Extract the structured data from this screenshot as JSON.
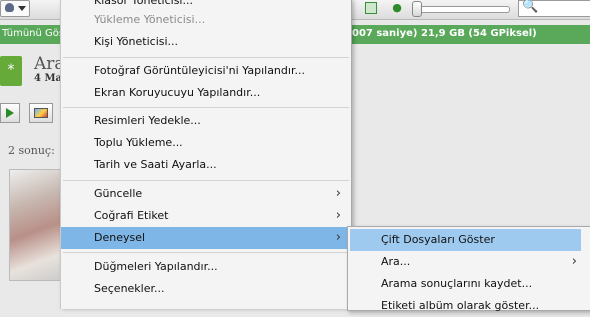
{
  "status_bar": {
    "show_all_label": "Tümünü Göst",
    "storage_info": "007 saniye) 21,9 GB (54 GPiksel)"
  },
  "toolbar": {
    "search_placeholder": ""
  },
  "album": {
    "title": "Ara",
    "date": "4 Ma"
  },
  "results": {
    "count_label": "2 sonuç:"
  },
  "menu": {
    "items": [
      {
        "label": "Klasör Yöneticisi..."
      },
      {
        "label": "Yükleme Yöneticisi..."
      },
      {
        "label": "Kişi Yöneticisi..."
      },
      {
        "label": "Fotoğraf Görüntüleyicisi'ni Yapılandır..."
      },
      {
        "label": "Ekran Koruyucuyu Yapılandır..."
      },
      {
        "label": "Resimleri Yedekle..."
      },
      {
        "label": "Toplu Yükleme..."
      },
      {
        "label": "Tarih ve Saati Ayarla..."
      },
      {
        "label": "Güncelle"
      },
      {
        "label": "Coğrafi Etiket"
      },
      {
        "label": "Deneysel"
      },
      {
        "label": "Düğmeleri Yapılandır..."
      },
      {
        "label": "Seçenekler..."
      }
    ]
  },
  "submenu": {
    "items": [
      {
        "label": "Çift Dosyaları Göster"
      },
      {
        "label": "Ara..."
      },
      {
        "label": "Arama sonuçlarını kaydet..."
      },
      {
        "label": "Etiketi albüm olarak göster..."
      }
    ]
  },
  "colors": {
    "status_bar": "#5aa85a",
    "highlight": "#7fb6e8",
    "submenu_highlight": "#9fcaf0"
  },
  "arrow_glyph": "›"
}
